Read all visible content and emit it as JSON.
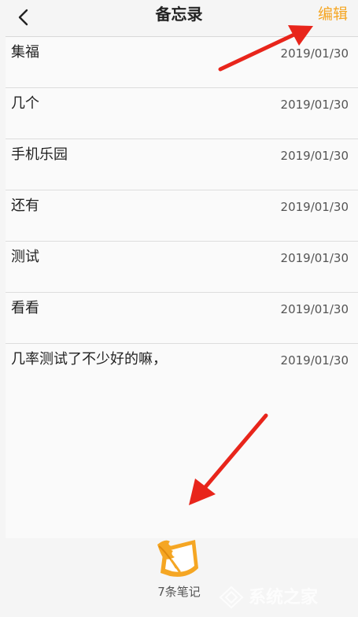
{
  "header": {
    "title": "备忘录",
    "edit_label": "编辑",
    "accent_color": "#f5a623"
  },
  "notes": [
    {
      "title": "集福",
      "date": "2019/01/30"
    },
    {
      "title": "几个",
      "date": "2019/01/30"
    },
    {
      "title": "手机乐园",
      "date": "2019/01/30"
    },
    {
      "title": "还有",
      "date": "2019/01/30"
    },
    {
      "title": "测试",
      "date": "2019/01/30"
    },
    {
      "title": "看看",
      "date": "2019/01/30"
    },
    {
      "title": "几率测试了不少好的嘛，",
      "date": "2019/01/30"
    }
  ],
  "footer": {
    "count_label": "7条笔记",
    "icon": "quill-note-icon"
  },
  "annotations": {
    "arrow_color": "#e8251b"
  },
  "watermark": {
    "text": "系统之家"
  }
}
